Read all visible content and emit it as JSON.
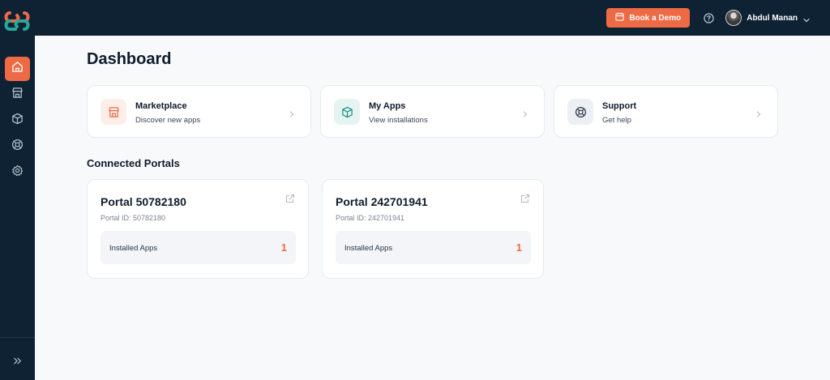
{
  "header": {
    "book_demo_label": "Book a Demo",
    "user_name": "Abdul Manan"
  },
  "sidebar": {
    "items": [
      {
        "icon": "home-icon",
        "active": true
      },
      {
        "icon": "store-icon",
        "active": false
      },
      {
        "icon": "box-icon",
        "active": false
      },
      {
        "icon": "lifebuoy-icon",
        "active": false
      },
      {
        "icon": "gear-icon",
        "active": false
      }
    ]
  },
  "page": {
    "title": "Dashboard"
  },
  "quick_links": [
    {
      "title": "Marketplace",
      "subtitle": "Discover new apps",
      "icon": "store-icon",
      "icon_color": "#ee6a45",
      "icon_bg": "#fdeee8"
    },
    {
      "title": "My Apps",
      "subtitle": "View installations",
      "icon": "box-icon",
      "icon_color": "#1f8f83",
      "icon_bg": "#e3f4f1"
    },
    {
      "title": "Support",
      "subtitle": "Get help",
      "icon": "lifebuoy-icon",
      "icon_color": "#2c3646",
      "icon_bg": "#eceff3"
    }
  ],
  "connected_portals": {
    "title": "Connected Portals",
    "items": [
      {
        "name": "Portal 50782180",
        "portal_id": "Portal ID: 50782180",
        "installed_label": "Installed Apps",
        "installed_count": "1"
      },
      {
        "name": "Portal 242701941",
        "portal_id": "Portal ID: 242701941",
        "installed_label": "Installed Apps",
        "installed_count": "1"
      }
    ]
  },
  "colors": {
    "accent": "#ee6a45",
    "navbar": "#0e2234",
    "background": "#f8f9fb"
  }
}
